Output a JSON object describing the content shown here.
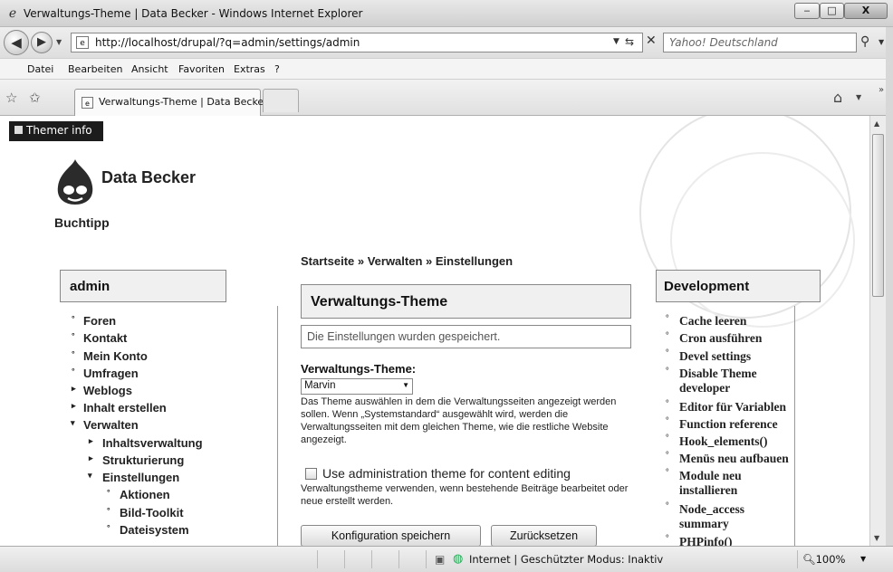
{
  "window": {
    "title": "Verwaltungs-Theme | Data Becker - Windows Internet Explorer",
    "min_label": "‒",
    "max_label": "□",
    "close_label": "X"
  },
  "address_bar": {
    "url": "http://localhost/drupal/?q=admin/settings/admin",
    "search_placeholder": "Yahoo! Deutschland"
  },
  "menu": [
    "Datei",
    "Bearbeiten",
    "Ansicht",
    "Favoriten",
    "Extras",
    "?"
  ],
  "tab": {
    "label": "Verwaltungs-Theme | Data Becker"
  },
  "page": {
    "themer_info": "Themer info",
    "site_name": "Data Becker",
    "slogan": "Buchtipp",
    "breadcrumb": "Startseite » Verwalten » Einstellungen",
    "title": "Verwaltungs-Theme",
    "status_message": "Die Einstellungen wurden gespeichert.",
    "theme_field": {
      "label": "Verwaltungs-Theme:",
      "selected": "Marvin",
      "description": "Das Theme auswählen in dem die Verwaltungsseiten angezeigt werden sollen. Wenn „Systemstandard“ ausgewählt wird, werden die Verwaltungsseiten mit dem gleichen Theme, wie die restliche Website angezeigt."
    },
    "node_admin": {
      "label": "Use administration theme for content editing",
      "checked": false,
      "description": "Verwaltungstheme verwenden, wenn bestehende Beiträge bearbeitet oder neue erstellt werden."
    },
    "buttons": {
      "save": "Konfiguration speichern",
      "reset": "Zurücksetzen"
    }
  },
  "left_block": {
    "title": "admin",
    "items": [
      {
        "label": "Foren",
        "marker": "°"
      },
      {
        "label": "Kontakt",
        "marker": "°"
      },
      {
        "label": "Mein Konto",
        "marker": "°"
      },
      {
        "label": "Umfragen",
        "marker": "°"
      },
      {
        "label": "Weblogs",
        "marker": "▸"
      },
      {
        "label": "Inhalt erstellen",
        "marker": "▸"
      },
      {
        "label": "Verwalten",
        "marker": "▾"
      },
      {
        "label": "Inhaltsverwaltung",
        "marker": "▸"
      },
      {
        "label": "Strukturierung",
        "marker": "▸"
      },
      {
        "label": "Einstellungen",
        "marker": "▾"
      },
      {
        "label": "Aktionen",
        "marker": "°"
      },
      {
        "label": "Bild-Toolkit",
        "marker": "°"
      },
      {
        "label": "Dateisystem",
        "marker": "°"
      }
    ]
  },
  "right_block": {
    "title": "Development",
    "items": [
      {
        "label": "Cache leeren"
      },
      {
        "label": "Cron ausführen"
      },
      {
        "label": "Devel settings"
      },
      {
        "label": "Disable Theme developer"
      },
      {
        "label": "Editor für Variablen"
      },
      {
        "label": "Function reference"
      },
      {
        "label": "Hook_elements()"
      },
      {
        "label": "Menüs neu aufbauen"
      },
      {
        "label": "Module neu installieren"
      },
      {
        "label": "Node_access summary"
      },
      {
        "label": "PHPinfo()"
      }
    ]
  },
  "status_bar": {
    "zone": "Internet | Geschützter Modus: Inaktiv",
    "zoom": "100%"
  }
}
